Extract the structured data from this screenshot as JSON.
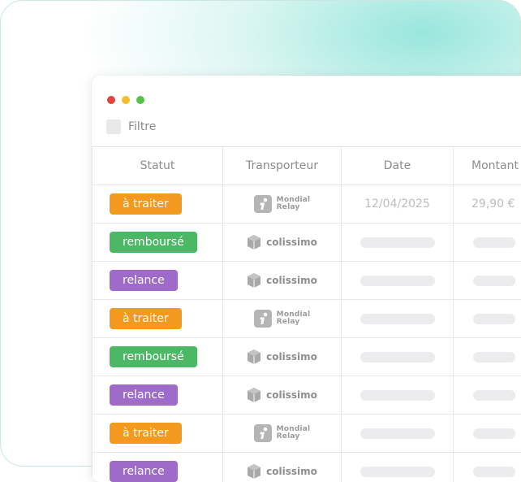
{
  "colors": {
    "dot_red": "#e2453c",
    "dot_yellow": "#f2bd2c",
    "dot_green": "#57c14b",
    "status_a_traiter": "#f39a1e",
    "status_rembourse": "#4cb764",
    "status_relance": "#9e6bc9"
  },
  "filter": {
    "label": "Filtre"
  },
  "table": {
    "headers": {
      "statut": "Statut",
      "transporteur": "Transporteur",
      "date": "Date",
      "montant": "Montant"
    },
    "rows": [
      {
        "status": "à traiter",
        "status_color": "#f39a1e",
        "carrier": "mondial-relay",
        "carrier_line1": "Mondial",
        "carrier_line2": "Relay",
        "date": "12/04/2025",
        "amount": "29,90 €"
      },
      {
        "status": "remboursé",
        "status_color": "#4cb764",
        "carrier": "colissimo",
        "carrier_name": "colissimo"
      },
      {
        "status": "relance",
        "status_color": "#9e6bc9",
        "carrier": "colissimo",
        "carrier_name": "colissimo"
      },
      {
        "status": "à traiter",
        "status_color": "#f39a1e",
        "carrier": "mondial-relay",
        "carrier_line1": "Mondial",
        "carrier_line2": "Relay"
      },
      {
        "status": "remboursé",
        "status_color": "#4cb764",
        "carrier": "colissimo",
        "carrier_name": "colissimo"
      },
      {
        "status": "relance",
        "status_color": "#9e6bc9",
        "carrier": "colissimo",
        "carrier_name": "colissimo"
      },
      {
        "status": "à traiter",
        "status_color": "#f39a1e",
        "carrier": "mondial-relay",
        "carrier_line1": "Mondial",
        "carrier_line2": "Relay"
      },
      {
        "status": "relance",
        "status_color": "#9e6bc9",
        "carrier": "colissimo",
        "carrier_name": "colissimo"
      }
    ]
  }
}
